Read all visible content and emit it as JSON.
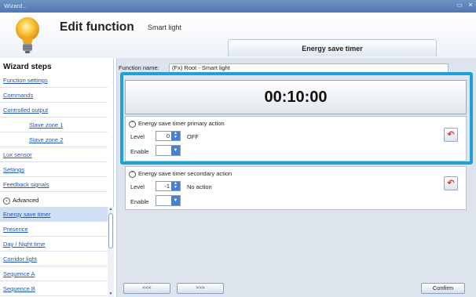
{
  "window": {
    "title": "Wizard...",
    "btn_max": "▭",
    "btn_close": "✕"
  },
  "header": {
    "title": "Edit function",
    "subtitle": "Smart light",
    "tab": "Energy save timer"
  },
  "sidebar": {
    "heading": "Wizard steps",
    "items": [
      {
        "label": "Function settings"
      },
      {
        "label": "Commands"
      },
      {
        "label": "Controlled output"
      },
      {
        "label": "Slave zone 1"
      },
      {
        "label": "Slave zone 2"
      },
      {
        "label": "Lux sensor"
      },
      {
        "label": "Settings"
      },
      {
        "label": "Feedback signals"
      }
    ],
    "advanced_label": "Advanced",
    "advanced_items": [
      {
        "label": "Energy save timer"
      },
      {
        "label": "Presence"
      },
      {
        "label": "Day / Night time"
      },
      {
        "label": "Corridor light"
      },
      {
        "label": "Sequence A"
      },
      {
        "label": "Sequence B"
      }
    ]
  },
  "main": {
    "function_name_label": "Function name:",
    "function_name_value": "(Fx) Root - Smart light",
    "timer_value": "00:10:00",
    "primary": {
      "title": "Energy save timer primary action",
      "level_label": "Level",
      "level_value": "0",
      "level_text": "OFF",
      "enable_label": "Enable"
    },
    "secondary": {
      "title": "Energy save timer secondary action",
      "level_label": "Level",
      "level_value": "-1",
      "level_text": "No action",
      "enable_label": "Enable"
    }
  },
  "footer": {
    "back": "<<<",
    "next": ">>>",
    "confirm": "Confirm"
  },
  "colors": {
    "accent": "#1ea1d8",
    "titlebar": "#5a80b8",
    "link": "#2255b8"
  }
}
